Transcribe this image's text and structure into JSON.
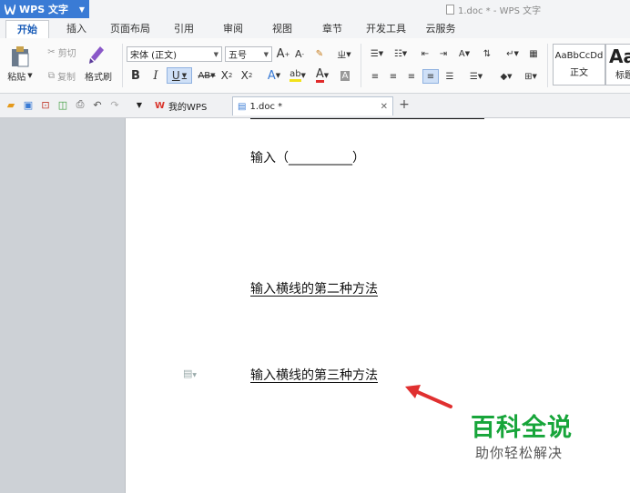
{
  "app": {
    "name": "WPS 文字",
    "window_title": "1.doc * - WPS 文字"
  },
  "ribbon_tabs": [
    "开始",
    "插入",
    "页面布局",
    "引用",
    "审阅",
    "视图",
    "章节",
    "开发工具",
    "云服务"
  ],
  "clipboard": {
    "paste": "粘贴",
    "cut": "剪切",
    "copy": "复制",
    "format_painter": "格式刷"
  },
  "font": {
    "family": "宋体 (正文)",
    "size": "五号"
  },
  "styles": {
    "normal_preview": "AaBbCcDd",
    "normal_label": "正文",
    "heading_preview": "Aa",
    "heading_label": "标题"
  },
  "doc_tabs": [
    {
      "label": "我的WPS"
    },
    {
      "label": "1.doc *"
    }
  ],
  "document": {
    "line1": "输入（__________）",
    "line2": "输入横线的第二种方法",
    "line3": "输入横线的第三种方法"
  },
  "watermark": {
    "title": "百科全说",
    "subtitle": "助你轻松解决"
  },
  "colors": {
    "accent": "#3a7bd5",
    "watermark_green": "#17a53a",
    "arrow_red": "#e03030"
  }
}
